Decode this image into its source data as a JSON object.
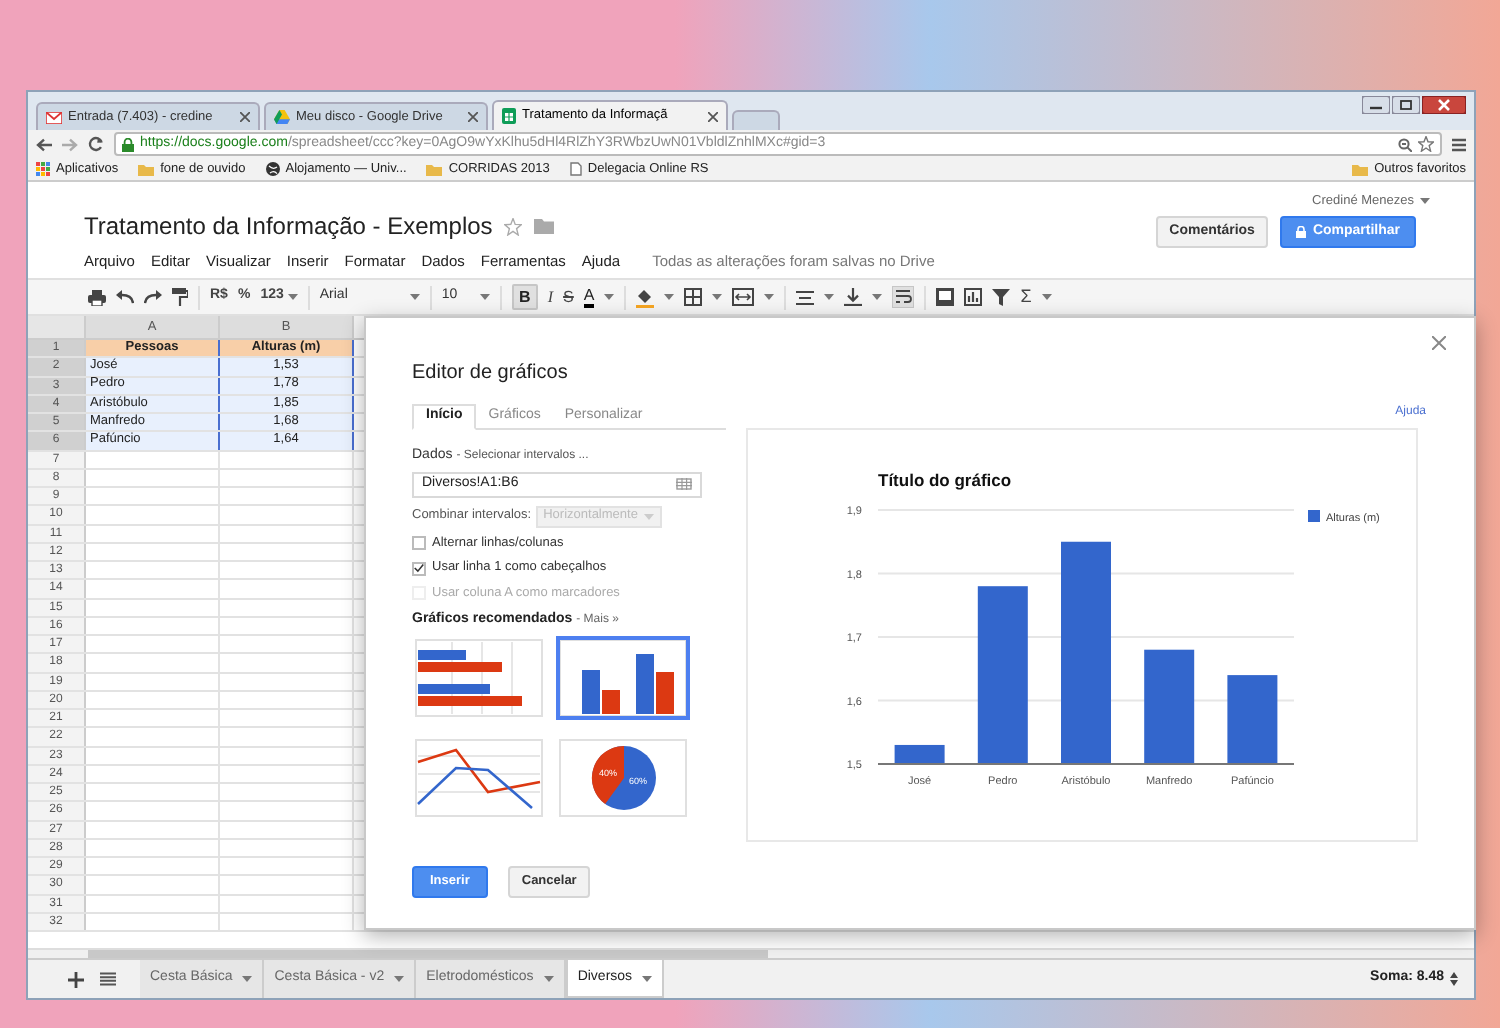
{
  "browser": {
    "tabs": [
      {
        "label": "Entrada (7.403) - credine",
        "selected": false
      },
      {
        "label": "Meu disco - Google Drive",
        "selected": false
      },
      {
        "label": "Tratamento da Informaçã",
        "selected": true
      }
    ],
    "url_origin": "https://docs.google.com",
    "url_rest": "/spreadsheet/ccc?key=0AgO9wYxKlhu5dHl4RlZhY3RWbzUwN01VbldlZnhlMXc#gid=3",
    "bookmarks": [
      {
        "label": "Aplicativos",
        "kind": "apps"
      },
      {
        "label": "fone de ouvido",
        "kind": "folder"
      },
      {
        "label": "Alojamento — Univ...",
        "kind": "site"
      },
      {
        "label": "CORRIDAS 2013",
        "kind": "folder"
      },
      {
        "label": "Delegacia Online RS",
        "kind": "page"
      }
    ],
    "other_bookmarks": "Outros favoritos"
  },
  "document": {
    "title": "Tratamento da Informação - Exemplos",
    "user": "Crediné Menezes",
    "menu": [
      "Arquivo",
      "Editar",
      "Visualizar",
      "Inserir",
      "Formatar",
      "Dados",
      "Ferramentas",
      "Ajuda"
    ],
    "save_status": "Todas as alterações foram salvas no Drive",
    "comments_button": "Comentários",
    "share_button": "Compartilhar"
  },
  "toolbar": {
    "currency": "R$",
    "percent": "%",
    "number_format": "123",
    "font": "Arial",
    "font_size": "10",
    "bold": "B",
    "bold_active": true,
    "italic": "I",
    "strikethrough": "S",
    "text_color": "A",
    "functions": "Σ"
  },
  "sheet": {
    "columns": [
      "A",
      "B"
    ],
    "rows": [
      {
        "number": "1",
        "kind": "header",
        "selected": true,
        "cells": [
          "Pessoas",
          "Alturas (m)"
        ]
      },
      {
        "number": "2",
        "kind": "data",
        "selected": true,
        "cells": [
          "José",
          "1,53"
        ]
      },
      {
        "number": "3",
        "kind": "data",
        "selected": true,
        "cells": [
          "Pedro",
          "1,78"
        ]
      },
      {
        "number": "4",
        "kind": "data",
        "selected": true,
        "cells": [
          "Aristóbulo",
          "1,85"
        ]
      },
      {
        "number": "5",
        "kind": "data",
        "selected": true,
        "cells": [
          "Manfredo",
          "1,68"
        ]
      },
      {
        "number": "6",
        "kind": "data",
        "selected": true,
        "cells": [
          "Pafúncio",
          "1,64"
        ]
      },
      {
        "number": "7",
        "kind": "data",
        "selected": false
      },
      {
        "number": "8",
        "kind": "data",
        "selected": false
      },
      {
        "number": "9",
        "kind": "data",
        "selected": false
      },
      {
        "number": "10",
        "kind": "data",
        "selected": false
      },
      {
        "number": "11",
        "kind": "data",
        "selected": false
      },
      {
        "number": "12",
        "kind": "data",
        "selected": false
      },
      {
        "number": "13",
        "kind": "data",
        "selected": false
      },
      {
        "number": "14",
        "kind": "data",
        "selected": false
      },
      {
        "number": "15",
        "kind": "data",
        "selected": false
      },
      {
        "number": "16",
        "kind": "data",
        "selected": false
      },
      {
        "number": "17",
        "kind": "data",
        "selected": false
      },
      {
        "number": "18",
        "kind": "data",
        "selected": false
      },
      {
        "number": "19",
        "kind": "data",
        "selected": false
      },
      {
        "number": "20",
        "kind": "data",
        "selected": false
      },
      {
        "number": "21",
        "kind": "data",
        "selected": false
      },
      {
        "number": "22",
        "kind": "data",
        "selected": false
      },
      {
        "number": "23",
        "kind": "data",
        "selected": false
      },
      {
        "number": "24",
        "kind": "data",
        "selected": false
      },
      {
        "number": "25",
        "kind": "data",
        "selected": false
      },
      {
        "number": "26",
        "kind": "data",
        "selected": false
      },
      {
        "number": "27",
        "kind": "data",
        "selected": false
      },
      {
        "number": "28",
        "kind": "data",
        "selected": false
      },
      {
        "number": "29",
        "kind": "data",
        "selected": false
      },
      {
        "number": "30",
        "kind": "data",
        "selected": false
      },
      {
        "number": "31",
        "kind": "data",
        "selected": false
      },
      {
        "number": "32",
        "kind": "data",
        "selected": false
      }
    ],
    "sheet_tabs": [
      {
        "label": "Cesta Básica",
        "selected": false
      },
      {
        "label": "Cesta Básica - v2",
        "selected": false
      },
      {
        "label": "Eletrodomésticos",
        "selected": false
      },
      {
        "label": "Diversos",
        "selected": true
      }
    ],
    "sum": "Soma: 8.48"
  },
  "dialog": {
    "title": "Editor de gráficos",
    "help_link": "Ajuda",
    "tabs": [
      {
        "label": "Início",
        "selected": true
      },
      {
        "label": "Gráficos",
        "selected": false
      },
      {
        "label": "Personalizar",
        "selected": false
      }
    ],
    "data_label": "Dados",
    "data_link": "- Selecionar intervalos ...",
    "range_value": "Diversos!A1:B6",
    "combine_label": "Combinar intervalos:",
    "combine_value": "Horizontalmente",
    "combine_disabled": true,
    "options": [
      {
        "label": "Alternar linhas/colunas",
        "checked": false,
        "disabled": false
      },
      {
        "label": "Usar linha 1 como cabeçalhos",
        "checked": true,
        "disabled": false
      },
      {
        "label": "Usar coluna A como marcadores",
        "checked": false,
        "disabled": true
      }
    ],
    "recommended_label": "Gráficos recomendados",
    "more_link": "- Mais »",
    "recommended_charts": [
      {
        "kind": "horizontal_bar",
        "selected": false
      },
      {
        "kind": "column",
        "selected": true
      },
      {
        "kind": "line",
        "selected": false
      },
      {
        "kind": "pie",
        "selected": false,
        "labels": [
          "40%",
          "60%"
        ]
      }
    ],
    "chart_data": {
      "type": "bar",
      "title": "Título do gráfico",
      "categories": [
        "José",
        "Pedro",
        "Aristóbulo",
        "Manfredo",
        "Pafúncio"
      ],
      "series": [
        {
          "name": "Alturas (m)",
          "color": "#3366cc",
          "values": [
            1.53,
            1.78,
            1.85,
            1.68,
            1.64
          ]
        }
      ],
      "grid": true,
      "ylim": [
        1.5,
        1.9
      ],
      "yticks": [
        {
          "value": 1.5,
          "label": "1,5"
        },
        {
          "value": 1.6,
          "label": "1,6"
        },
        {
          "value": 1.7,
          "label": "1,7"
        },
        {
          "value": 1.8,
          "label": "1,8"
        },
        {
          "value": 1.9,
          "label": "1,9"
        }
      ]
    },
    "insert_button": "Inserir",
    "cancel_button": "Cancelar"
  }
}
